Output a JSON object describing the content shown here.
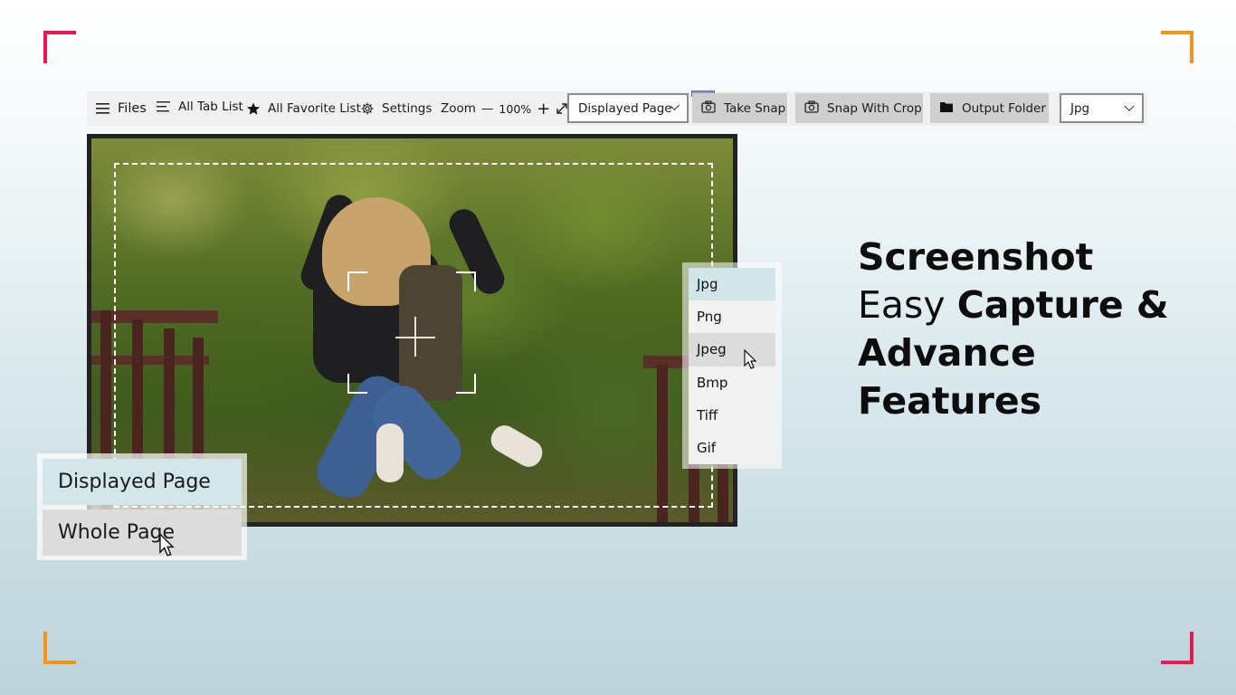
{
  "toolbar": {
    "files": "Files",
    "all_tab_list": "All Tab List",
    "all_favorite_list": "All Favorite List",
    "settings": "Settings",
    "zoom_label": "Zoom",
    "zoom_minus": "—",
    "zoom_value": "100%",
    "zoom_plus": "+",
    "capture_mode": "Displayed Page",
    "take_snap": "Take Snap",
    "snap_with_crop": "Snap With Crop",
    "output_folder": "Output Folder",
    "format": "Jpg"
  },
  "format_menu": {
    "items": [
      "Jpg",
      "Png",
      "Jpeg",
      "Bmp",
      "Tiff",
      "Gif"
    ],
    "selected": "Jpg",
    "hovered": "Jpeg"
  },
  "capture_menu": {
    "items": [
      "Displayed Page",
      "Whole Page"
    ],
    "selected": "Displayed Page",
    "hovered": "Whole Page"
  },
  "headline": {
    "line1": "Screenshot",
    "line2_light": "Easy",
    "line2_bold": "Capture &",
    "line3": "Advance",
    "line4": "Features"
  },
  "colors": {
    "corner_red": "#e8194f",
    "corner_orange": "#f3951c",
    "selected_item": "#d2e6ea"
  },
  "icons": [
    "menu-icon",
    "list-icon",
    "star-icon",
    "gear-icon",
    "expand-icon",
    "camera-icon",
    "folder-icon",
    "chevron-down-icon",
    "cursor-icon"
  ]
}
